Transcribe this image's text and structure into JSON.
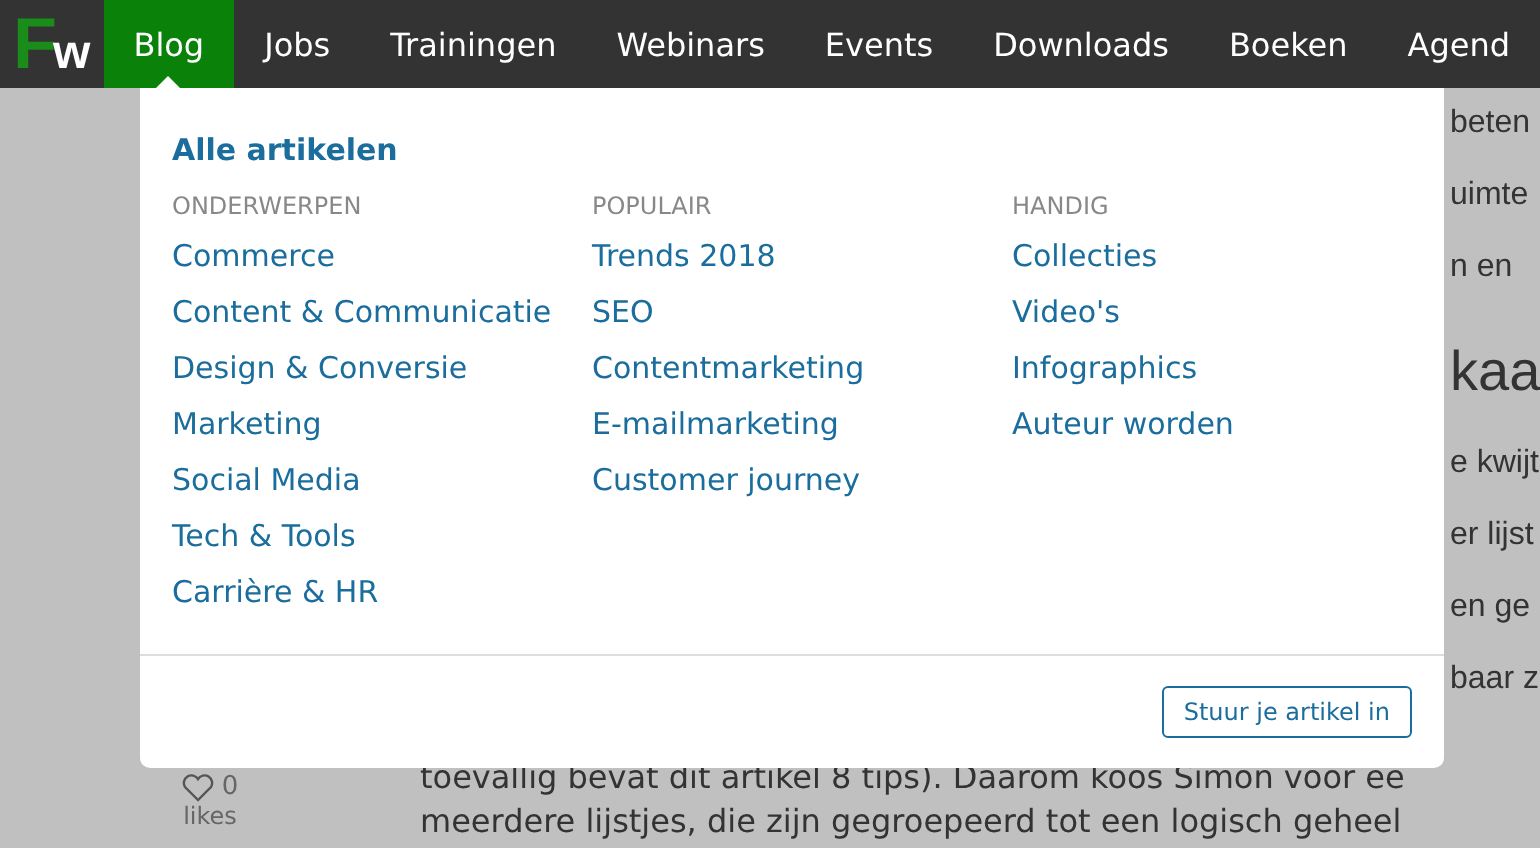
{
  "logo": {
    "first": "F",
    "second": "w"
  },
  "nav": [
    {
      "label": "Blog",
      "selected": true
    },
    {
      "label": "Jobs",
      "selected": false
    },
    {
      "label": "Trainingen",
      "selected": false
    },
    {
      "label": "Webinars",
      "selected": false
    },
    {
      "label": "Events",
      "selected": false
    },
    {
      "label": "Downloads",
      "selected": false
    },
    {
      "label": "Boeken",
      "selected": false
    },
    {
      "label": "Agend",
      "selected": false
    }
  ],
  "menu": {
    "all_link": "Alle artikelen",
    "columns": [
      {
        "heading": "ONDERWERPEN",
        "links": [
          "Commerce",
          "Content & Communicatie",
          "Design & Conversie",
          "Marketing",
          "Social Media",
          "Tech & Tools",
          "Carrière & HR"
        ]
      },
      {
        "heading": "POPULAIR",
        "links": [
          "Trends 2018",
          "SEO",
          "Contentmarketing",
          "E-mailmarketing",
          "Customer journey"
        ]
      },
      {
        "heading": "HANDIG",
        "links": [
          "Collecties",
          "Video's",
          "Infographics",
          "Auteur worden"
        ]
      }
    ],
    "button": "Stuur je artikel in"
  },
  "article": {
    "fragments": [
      {
        "kind": "line",
        "text": "beten"
      },
      {
        "kind": "line",
        "text": "uimte"
      },
      {
        "kind": "line",
        "text": "n en"
      },
      {
        "kind": "heading",
        "text": "kaa"
      },
      {
        "kind": "line",
        "text": "e kwijt"
      },
      {
        "kind": "line",
        "text": "er lijst"
      },
      {
        "kind": "line",
        "text": "en ge"
      },
      {
        "kind": "line",
        "text": "baar z"
      }
    ],
    "lines": [
      "toevallig bevat dit artikel 8 tips). Daarom koos Simon voor ee",
      "meerdere lijstjes, die zijn gegroepeerd tot een logisch geheel"
    ]
  },
  "likes": {
    "count": "0",
    "label": "likes"
  }
}
